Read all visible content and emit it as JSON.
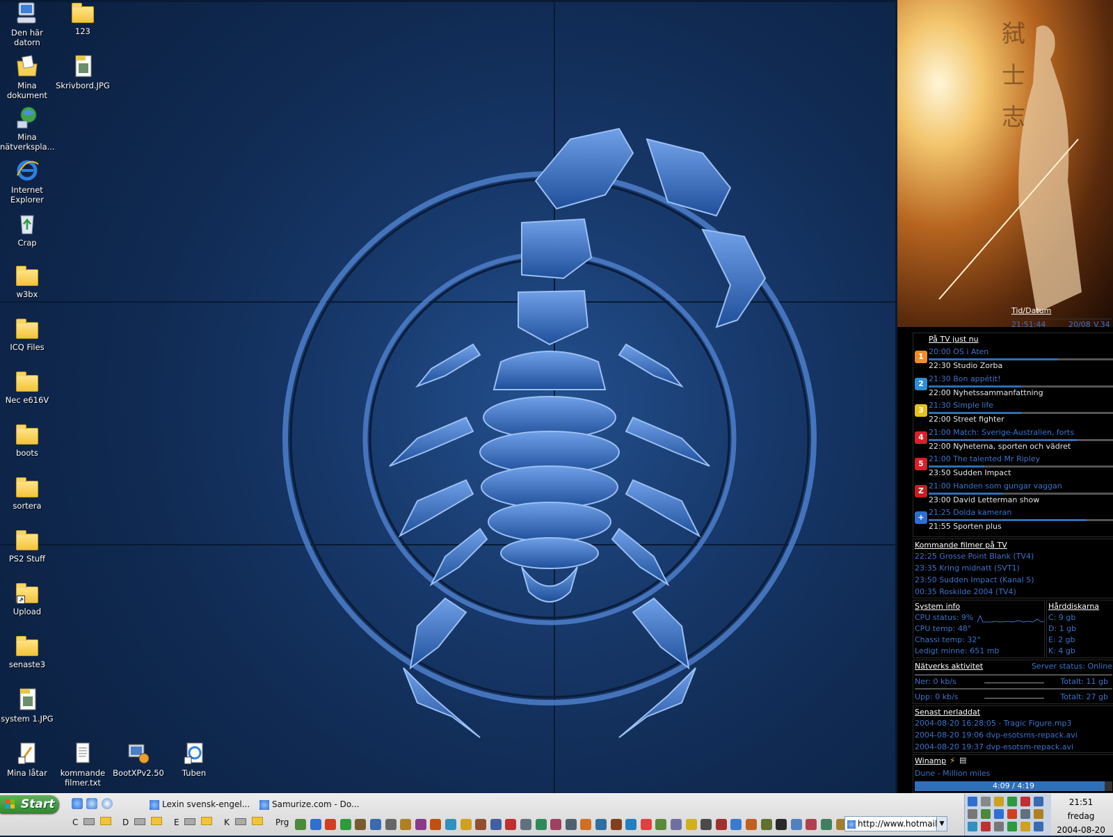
{
  "desktop": {
    "icons": [
      {
        "label": "Den här datorn",
        "kind": "computer"
      },
      {
        "label": "Mina dokument",
        "kind": "documents"
      },
      {
        "label": "Mina nätverkspla...",
        "kind": "network"
      },
      {
        "label": "Internet Explorer",
        "kind": "ie"
      },
      {
        "label": "Crap",
        "kind": "recycle"
      },
      {
        "label": "w3bx",
        "kind": "folder"
      },
      {
        "label": "ICQ Files",
        "kind": "folder"
      },
      {
        "label": "Nec e616V",
        "kind": "folder"
      },
      {
        "label": "boots",
        "kind": "folder"
      },
      {
        "label": "sortera",
        "kind": "folder"
      },
      {
        "label": "PS2 Stuff",
        "kind": "folder"
      },
      {
        "label": "Upload",
        "kind": "folder-shortcut"
      },
      {
        "label": "senaste3",
        "kind": "folder"
      },
      {
        "label": "system 1.JPG",
        "kind": "jpg"
      },
      {
        "label": "Mina låtar",
        "kind": "shortcut-doc"
      },
      {
        "label": "123",
        "kind": "folder"
      },
      {
        "label": "Skrivbord.JPG",
        "kind": "jpg"
      },
      {
        "label": "kommande filmer.txt",
        "kind": "txt"
      },
      {
        "label": "BootXPv2.50",
        "kind": "app"
      },
      {
        "label": "Tuben",
        "kind": "ie-shortcut"
      }
    ]
  },
  "sidebar": {
    "time_date": {
      "title": "Tid/Datum",
      "time": "21:51:44",
      "date": "20/08",
      "week": "V.34"
    },
    "tv_now": {
      "title": "På TV just nu",
      "channels": [
        {
          "logo": "1",
          "color": "#f08c28",
          "now": "20:00 OS i Aten",
          "next": "22:30 Studio Zorba",
          "progress": 0.7
        },
        {
          "logo": "2",
          "color": "#2b8fd8",
          "now": "21:30 Bon appétit!",
          "next": "22:00 Nyhetssammanfattning",
          "progress": 0.5
        },
        {
          "logo": "3",
          "color": "#e8c01c",
          "now": "21:30 Simple life",
          "next": "22:00 Street fighter",
          "progress": 0.5
        },
        {
          "logo": "4",
          "color": "#d8202a",
          "now": "21:00 Match: Sverige-Australien, forts",
          "next": "22:00 Nyheterna, sporten och vädret",
          "progress": 0.8
        },
        {
          "logo": "5",
          "color": "#d8202a",
          "now": "21:00 The talented Mr Ripley",
          "next": "23:50 Sudden Impact",
          "progress": 0.3
        },
        {
          "logo": "Z",
          "color": "#c42020",
          "now": "21:00 Handen som gungar vaggan",
          "next": "23:00 David Letterman show",
          "progress": 0.4
        },
        {
          "logo": "+",
          "color": "#2b6fd0",
          "now": "21:25 Dolda kameran",
          "next": "21:55 Sporten plus",
          "progress": 0.85
        }
      ]
    },
    "upcoming": {
      "title": "Kommande filmer på TV",
      "items": [
        "22:25 Grosse Point Blank (TV4)",
        "23:35 Kring midnatt (SVT1)",
        "23:50 Sudden Impact (Kanal 5)",
        "00:35 Roskilde 2004 (TV4)"
      ]
    },
    "system": {
      "title": "System info",
      "cpu_status": "CPU status: 9%",
      "cpu_temp": "CPU temp:  48°",
      "chassi_temp": "Chassi temp:  32°",
      "free_mem": "Ledigt minne: 651 mb"
    },
    "disks": {
      "title": "Hårddiskarna",
      "items": [
        "C: 9 gb",
        "D: 1 gb",
        "E: 2 gb",
        "K: 4 gb"
      ]
    },
    "network": {
      "title": "Nätverks aktivitet",
      "server_status": "Server status: Online",
      "down": "Ner: 0 kb/s",
      "down_total": "Totalt: 11 gb",
      "up": "Upp: 0 kb/s",
      "up_total": "Totalt: 27 gb"
    },
    "downloads": {
      "title": "Senast nerladdat",
      "items": [
        "2004-08-20 16:28:05 - Tragic Figure.mp3",
        "2004-08-20 19:06 dvp-esotsms-repack.avi",
        "2004-08-20 19:37 dvp-esotsm-repack.avi"
      ]
    },
    "winamp": {
      "title": "Winamp",
      "track": "Dune - Million miles",
      "time": "4:09 / 4:19",
      "progress": 0.96
    }
  },
  "taskbar": {
    "start_label": "Start",
    "windows": [
      {
        "label": "Lexin svensk-engel..."
      },
      {
        "label": "Samurize.com - Do..."
      }
    ],
    "drives": [
      "C",
      "D",
      "E",
      "K"
    ],
    "prg_label": "Prg",
    "address_value": "http://www.hotmail",
    "clock_time": "21:51",
    "clock_day": "fredag",
    "clock_date": "2004-08-20"
  }
}
